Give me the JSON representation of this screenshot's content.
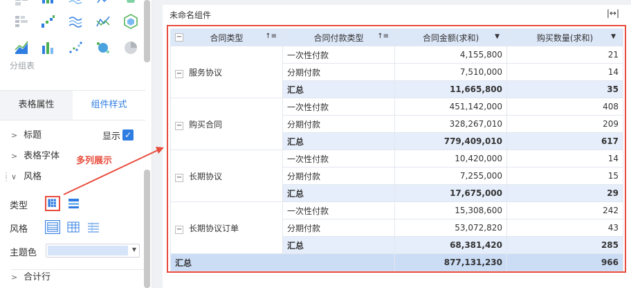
{
  "left_panel": {
    "group_label": "分组表",
    "tabs": [
      {
        "label": "表格属性"
      },
      {
        "label": "组件样式"
      }
    ],
    "sections": {
      "title": "标题",
      "table_font": "表格字体",
      "style": "风格",
      "total_row": "合计行"
    },
    "show_label": "显示",
    "type_label": "类型",
    "style_label": "风格",
    "theme_label": "主题色",
    "annotation": "多列展示",
    "colors": {
      "accent": "#2f7de1",
      "annotation": "#e84c3d",
      "theme_swatch": "#d6e4f9"
    }
  },
  "component": {
    "title": "未命名组件",
    "headers": [
      "合同类型",
      "合同付款类型",
      "合同金额(求和)",
      "购买数量(求和)"
    ],
    "groups": [
      {
        "name": "服务协议",
        "rows": [
          {
            "type": "一次性付款",
            "amount": "4,155,800",
            "qty": "21"
          },
          {
            "type": "分期付款",
            "amount": "7,510,000",
            "qty": "14"
          }
        ],
        "subtotal": {
          "label": "汇总",
          "amount": "11,665,800",
          "qty": "35"
        }
      },
      {
        "name": "购买合同",
        "rows": [
          {
            "type": "一次性付款",
            "amount": "451,142,000",
            "qty": "408"
          },
          {
            "type": "分期付款",
            "amount": "328,267,010",
            "qty": "209"
          }
        ],
        "subtotal": {
          "label": "汇总",
          "amount": "779,409,010",
          "qty": "617"
        }
      },
      {
        "name": "长期协议",
        "rows": [
          {
            "type": "一次性付款",
            "amount": "10,420,000",
            "qty": "14"
          },
          {
            "type": "分期付款",
            "amount": "7,255,000",
            "qty": "15"
          }
        ],
        "subtotal": {
          "label": "汇总",
          "amount": "17,675,000",
          "qty": "29"
        }
      },
      {
        "name": "长期协议订单",
        "rows": [
          {
            "type": "一次性付款",
            "amount": "15,308,600",
            "qty": "242"
          },
          {
            "type": "分期付款",
            "amount": "53,072,820",
            "qty": "43"
          }
        ],
        "subtotal": {
          "label": "汇总",
          "amount": "68,381,420",
          "qty": "285"
        }
      }
    ],
    "grand_total": {
      "label": "汇总",
      "amount": "877,131,230",
      "qty": "966"
    }
  }
}
